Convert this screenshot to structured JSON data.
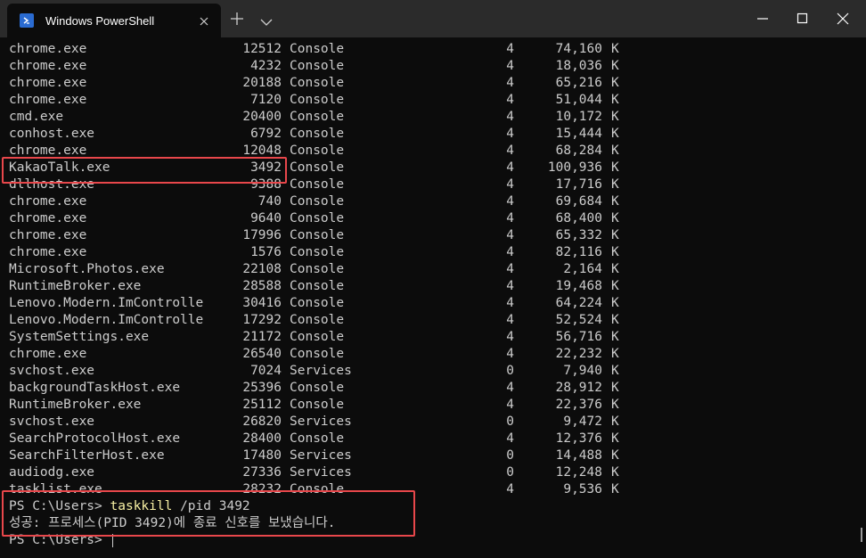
{
  "window": {
    "tab_title": "Windows PowerShell"
  },
  "process_rows": [
    {
      "name": "chrome.exe",
      "pid": "12512",
      "session": "Console",
      "num": "4",
      "mem": "74,160",
      "unit": "K"
    },
    {
      "name": "chrome.exe",
      "pid": "4232",
      "session": "Console",
      "num": "4",
      "mem": "18,036",
      "unit": "K"
    },
    {
      "name": "chrome.exe",
      "pid": "20188",
      "session": "Console",
      "num": "4",
      "mem": "65,216",
      "unit": "K"
    },
    {
      "name": "chrome.exe",
      "pid": "7120",
      "session": "Console",
      "num": "4",
      "mem": "51,044",
      "unit": "K"
    },
    {
      "name": "cmd.exe",
      "pid": "20400",
      "session": "Console",
      "num": "4",
      "mem": "10,172",
      "unit": "K"
    },
    {
      "name": "conhost.exe",
      "pid": "6792",
      "session": "Console",
      "num": "4",
      "mem": "15,444",
      "unit": "K"
    },
    {
      "name": "chrome.exe",
      "pid": "12048",
      "session": "Console",
      "num": "4",
      "mem": "68,284",
      "unit": "K"
    },
    {
      "name": "KakaoTalk.exe",
      "pid": "3492",
      "session": "Console",
      "num": "4",
      "mem": "100,936",
      "unit": "K"
    },
    {
      "name": "dllhost.exe",
      "pid": "9388",
      "session": "Console",
      "num": "4",
      "mem": "17,716",
      "unit": "K"
    },
    {
      "name": "chrome.exe",
      "pid": "740",
      "session": "Console",
      "num": "4",
      "mem": "69,684",
      "unit": "K"
    },
    {
      "name": "chrome.exe",
      "pid": "9640",
      "session": "Console",
      "num": "4",
      "mem": "68,400",
      "unit": "K"
    },
    {
      "name": "chrome.exe",
      "pid": "17996",
      "session": "Console",
      "num": "4",
      "mem": "65,332",
      "unit": "K"
    },
    {
      "name": "chrome.exe",
      "pid": "1576",
      "session": "Console",
      "num": "4",
      "mem": "82,116",
      "unit": "K"
    },
    {
      "name": "Microsoft.Photos.exe",
      "pid": "22108",
      "session": "Console",
      "num": "4",
      "mem": "2,164",
      "unit": "K"
    },
    {
      "name": "RuntimeBroker.exe",
      "pid": "28588",
      "session": "Console",
      "num": "4",
      "mem": "19,468",
      "unit": "K"
    },
    {
      "name": "Lenovo.Modern.ImControlle",
      "pid": "30416",
      "session": "Console",
      "num": "4",
      "mem": "64,224",
      "unit": "K"
    },
    {
      "name": "Lenovo.Modern.ImControlle",
      "pid": "17292",
      "session": "Console",
      "num": "4",
      "mem": "52,524",
      "unit": "K"
    },
    {
      "name": "SystemSettings.exe",
      "pid": "21172",
      "session": "Console",
      "num": "4",
      "mem": "56,716",
      "unit": "K"
    },
    {
      "name": "chrome.exe",
      "pid": "26540",
      "session": "Console",
      "num": "4",
      "mem": "22,232",
      "unit": "K"
    },
    {
      "name": "svchost.exe",
      "pid": "7024",
      "session": "Services",
      "num": "0",
      "mem": "7,940",
      "unit": "K"
    },
    {
      "name": "backgroundTaskHost.exe",
      "pid": "25396",
      "session": "Console",
      "num": "4",
      "mem": "28,912",
      "unit": "K"
    },
    {
      "name": "RuntimeBroker.exe",
      "pid": "25112",
      "session": "Console",
      "num": "4",
      "mem": "22,376",
      "unit": "K"
    },
    {
      "name": "svchost.exe",
      "pid": "26820",
      "session": "Services",
      "num": "0",
      "mem": "9,472",
      "unit": "K"
    },
    {
      "name": "SearchProtocolHost.exe",
      "pid": "28400",
      "session": "Console",
      "num": "4",
      "mem": "12,376",
      "unit": "K"
    },
    {
      "name": "SearchFilterHost.exe",
      "pid": "17480",
      "session": "Services",
      "num": "0",
      "mem": "14,488",
      "unit": "K"
    },
    {
      "name": "audiodg.exe",
      "pid": "27336",
      "session": "Services",
      "num": "0",
      "mem": "12,248",
      "unit": "K"
    },
    {
      "name": "tasklist.exe",
      "pid": "28232",
      "session": "Console",
      "num": "4",
      "mem": "9,536",
      "unit": "K"
    }
  ],
  "command": {
    "prompt": "PS C:\\Users> ",
    "name": "taskkill",
    "args": " /pid ",
    "pid": "3492"
  },
  "result_message": "성공: 프로세스(PID 3492)에 종료 신호를 보냈습니다.",
  "next_prompt": "PS C:\\Users> ",
  "colors": {
    "highlight": "#e8474b",
    "command": "#f9f1a5",
    "background": "#0c0c0c"
  }
}
